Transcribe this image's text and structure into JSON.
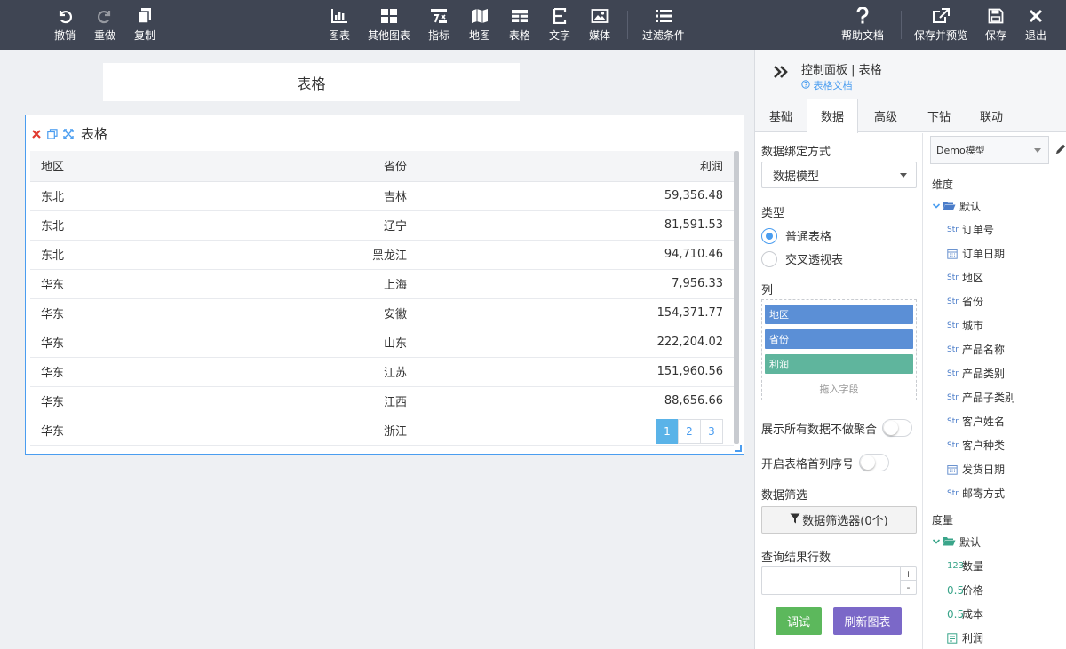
{
  "toolbar": {
    "left": [
      {
        "label": "撤销",
        "icon": "undo-icon"
      },
      {
        "label": "重做",
        "icon": "redo-icon"
      },
      {
        "label": "复制",
        "icon": "copy-icon"
      }
    ],
    "center": [
      {
        "label": "图表",
        "icon": "bar-chart-icon"
      },
      {
        "label": "其他图表",
        "icon": "grid-icon"
      },
      {
        "label": "指标",
        "icon": "indicator-icon"
      },
      {
        "label": "地图",
        "icon": "map-icon"
      },
      {
        "label": "表格",
        "icon": "table-icon"
      },
      {
        "label": "文字",
        "icon": "text-icon"
      },
      {
        "label": "媒体",
        "icon": "image-icon"
      },
      {
        "label": "过滤条件",
        "icon": "list-icon"
      }
    ],
    "right": [
      {
        "label": "帮助文档",
        "icon": "question-icon"
      },
      {
        "label": "保存并预览",
        "icon": "external-link-icon"
      },
      {
        "label": "保存",
        "icon": "save-icon"
      },
      {
        "label": "退出",
        "icon": "close-icon"
      }
    ]
  },
  "canvas": {
    "title_card": "表格",
    "widget": {
      "title": "表格",
      "columns": [
        "地区",
        "省份",
        "利润"
      ],
      "rows": [
        [
          "东北",
          "吉林",
          "59,356.48"
        ],
        [
          "东北",
          "辽宁",
          "81,591.53"
        ],
        [
          "东北",
          "黑龙江",
          "94,710.46"
        ],
        [
          "华东",
          "上海",
          "7,956.33"
        ],
        [
          "华东",
          "安徽",
          "154,371.77"
        ],
        [
          "华东",
          "山东",
          "222,204.02"
        ],
        [
          "华东",
          "江苏",
          "151,960.56"
        ],
        [
          "华东",
          "江西",
          "88,656.66"
        ],
        [
          "华东",
          "浙江",
          ""
        ]
      ],
      "pages": [
        "1",
        "2",
        "3"
      ],
      "active_page": "1"
    }
  },
  "panel": {
    "title": "控制面板 | 表格",
    "doc_link": "表格文档",
    "tabs": [
      "基础",
      "数据",
      "高级",
      "下钻",
      "联动"
    ],
    "active_tab": "数据",
    "binding_label": "数据绑定方式",
    "binding_value": "数据模型",
    "type_label": "类型",
    "type_options": [
      "普通表格",
      "交叉透视表"
    ],
    "type_selected": "普通表格",
    "columns_label": "列",
    "column_chips": [
      {
        "label": "地区",
        "kind": "dimension"
      },
      {
        "label": "省份",
        "kind": "dimension"
      },
      {
        "label": "利润",
        "kind": "measure"
      }
    ],
    "drop_hint": "拖入字段",
    "toggle_all_data": "展示所有数据不做聚合",
    "toggle_serial": "开启表格首列序号",
    "filter_label": "数据筛选",
    "filter_button": "数据筛选器(0个)",
    "rows_label": "查询结果行数",
    "rows_value": "",
    "debug_button": "调试",
    "refresh_button": "刷新图表",
    "model": "Demo模型",
    "dimension_label": "维度",
    "dimension_group": "默认",
    "dimension_fields": [
      {
        "type": "Str",
        "name": "订单号"
      },
      {
        "type": "date",
        "name": "订单日期"
      },
      {
        "type": "Str",
        "name": "地区"
      },
      {
        "type": "Str",
        "name": "省份"
      },
      {
        "type": "Str",
        "name": "城市"
      },
      {
        "type": "Str",
        "name": "产品名称"
      },
      {
        "type": "Str",
        "name": "产品类别"
      },
      {
        "type": "Str",
        "name": "产品子类别"
      },
      {
        "type": "Str",
        "name": "客户姓名"
      },
      {
        "type": "Str",
        "name": "客户种类"
      },
      {
        "type": "date",
        "name": "发货日期"
      },
      {
        "type": "Str",
        "name": "邮寄方式"
      }
    ],
    "measure_label": "度量",
    "measure_group": "默认",
    "measure_fields": [
      {
        "type": "123",
        "name": "数量"
      },
      {
        "type": "0.5",
        "name": "价格"
      },
      {
        "type": "0.5",
        "name": "成本"
      },
      {
        "type": "calc",
        "name": "利润"
      }
    ]
  },
  "colors": {
    "toolbar_bg": "#3f4553",
    "accent": "#4a9df0",
    "chip_blue": "#5b8fd6",
    "chip_green": "#5fb59d",
    "debug_green": "#5cb85c",
    "refresh_purple": "#7b68c8"
  }
}
